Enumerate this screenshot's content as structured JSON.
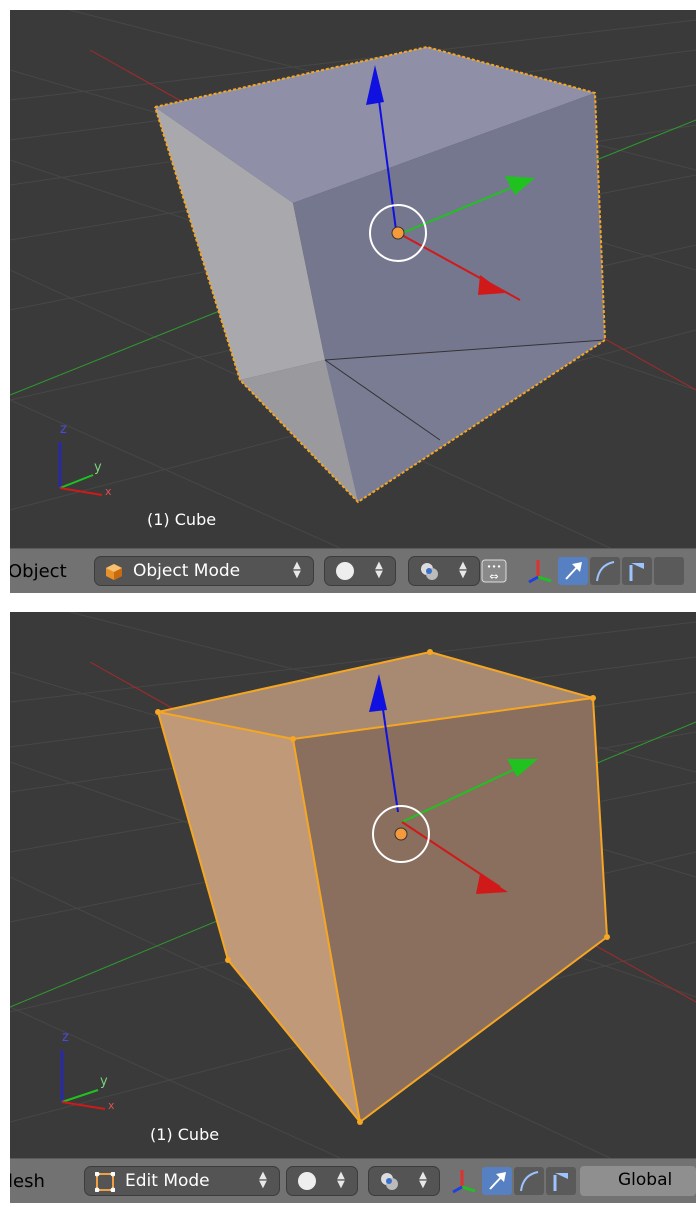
{
  "object_panel": {
    "viewport": {
      "object_label": "(1) Cube",
      "axis_labels": {
        "z": "z",
        "y": "y",
        "x": "x"
      }
    },
    "header": {
      "menu_label": "Object",
      "mode_dropdown": {
        "label": "Object Mode",
        "icon": "cube-icon"
      },
      "shading_icon": "sphere-icon",
      "pivot_icon": "pivot-icon",
      "transform_manipulator_icon": "manipulator-icon",
      "translate_icon": "translate-arrow-icon",
      "rotate_icon": "rotate-icon",
      "scale_icon": "scale-icon"
    }
  },
  "edit_panel": {
    "viewport": {
      "object_label": "(1) Cube",
      "axis_labels": {
        "z": "z",
        "y": "y",
        "x": "x"
      }
    },
    "header": {
      "menu_label": "lesh",
      "mode_dropdown": {
        "label": "Edit Mode",
        "icon": "edit-mesh-icon"
      },
      "shading_icon": "sphere-icon",
      "pivot_icon": "pivot-icon",
      "transform_manipulator_icon": "manipulator-icon",
      "translate_icon": "translate-arrow-icon",
      "rotate_icon": "rotate-icon",
      "scale_icon": "scale-icon",
      "orientation_label": "Global"
    }
  },
  "colors": {
    "background": "#3a3a3a",
    "grid": "#444444",
    "header": "#727272",
    "selection": "#f5a623",
    "x_axis": "#d01a1a",
    "y_axis": "#1fc21f",
    "z_axis": "#1010e0",
    "active_button": "#5680c2"
  }
}
